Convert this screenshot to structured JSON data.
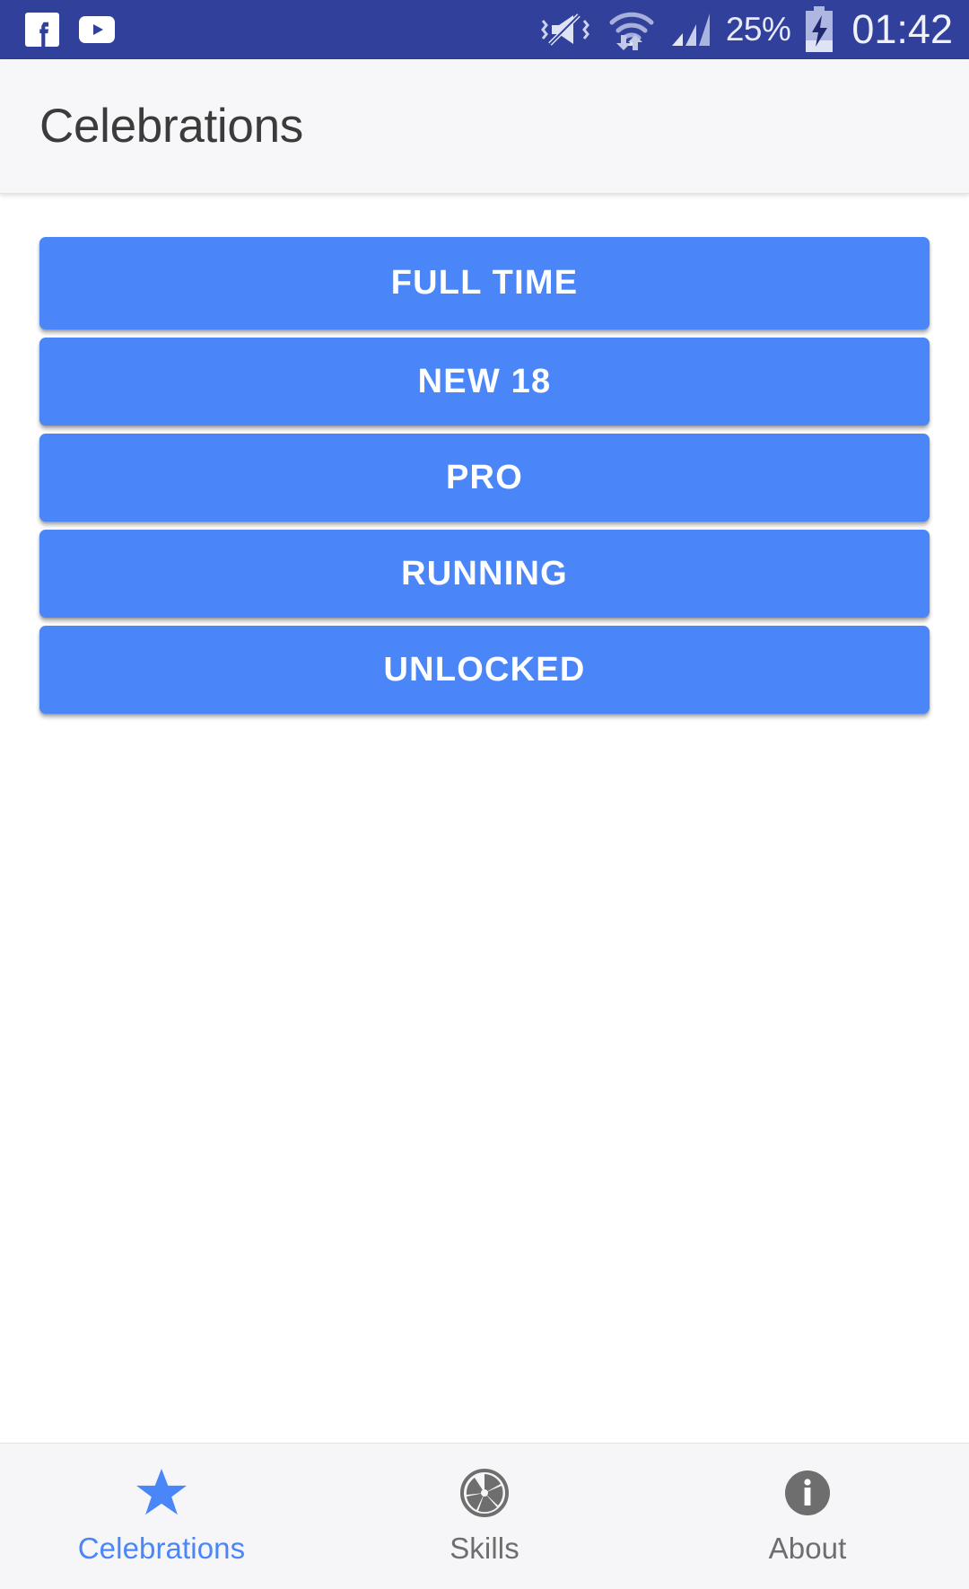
{
  "status_bar": {
    "notification_icons": [
      "facebook-icon",
      "youtube-icon"
    ],
    "system_icons": [
      "vibrate-mute-icon",
      "wifi-data-icon",
      "cellular-signal-icon"
    ],
    "battery_percent": "25%",
    "battery_state": "charging",
    "time": "01:42",
    "background_color": "#31409b"
  },
  "app_bar": {
    "title": "Celebrations",
    "background_color": "#f7f7f9",
    "text_color": "#3b3b3b"
  },
  "main": {
    "buttons": [
      {
        "label": "FULL TIME"
      },
      {
        "label": "NEW 18"
      },
      {
        "label": "PRO"
      },
      {
        "label": "RUNNING"
      },
      {
        "label": "UNLOCKED"
      }
    ],
    "button_color": "#4a86f7",
    "button_text_color": "#ffffff"
  },
  "bottom_nav": {
    "active_color": "#4a86f7",
    "inactive_color": "#6e6e6e",
    "items": [
      {
        "label": "Celebrations",
        "icon": "star-icon",
        "active": true
      },
      {
        "label": "Skills",
        "icon": "aperture-icon",
        "active": false
      },
      {
        "label": "About",
        "icon": "info-circle-icon",
        "active": false
      }
    ]
  }
}
